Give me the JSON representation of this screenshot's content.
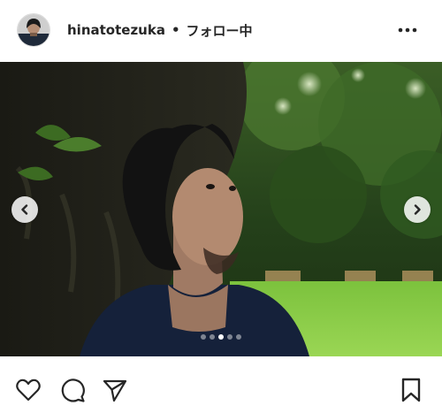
{
  "header": {
    "username": "hinatotezuka",
    "separator": "•",
    "follow_status": "フォロー中",
    "avatar_icon": "profile-avatar",
    "more_icon": "more-options-icon"
  },
  "carousel": {
    "slide_count": 5,
    "active_index": 2,
    "prev_icon": "chevron-left-icon",
    "next_icon": "chevron-right-icon"
  },
  "actions": {
    "like_icon": "heart-icon",
    "comment_icon": "comment-bubble-icon",
    "share_icon": "paper-plane-icon",
    "save_icon": "bookmark-icon"
  },
  "colors": {
    "text": "#262626",
    "dot_active": "#ffffff",
    "grass": "#8fcf4a",
    "foliage": "#2f5a20"
  }
}
